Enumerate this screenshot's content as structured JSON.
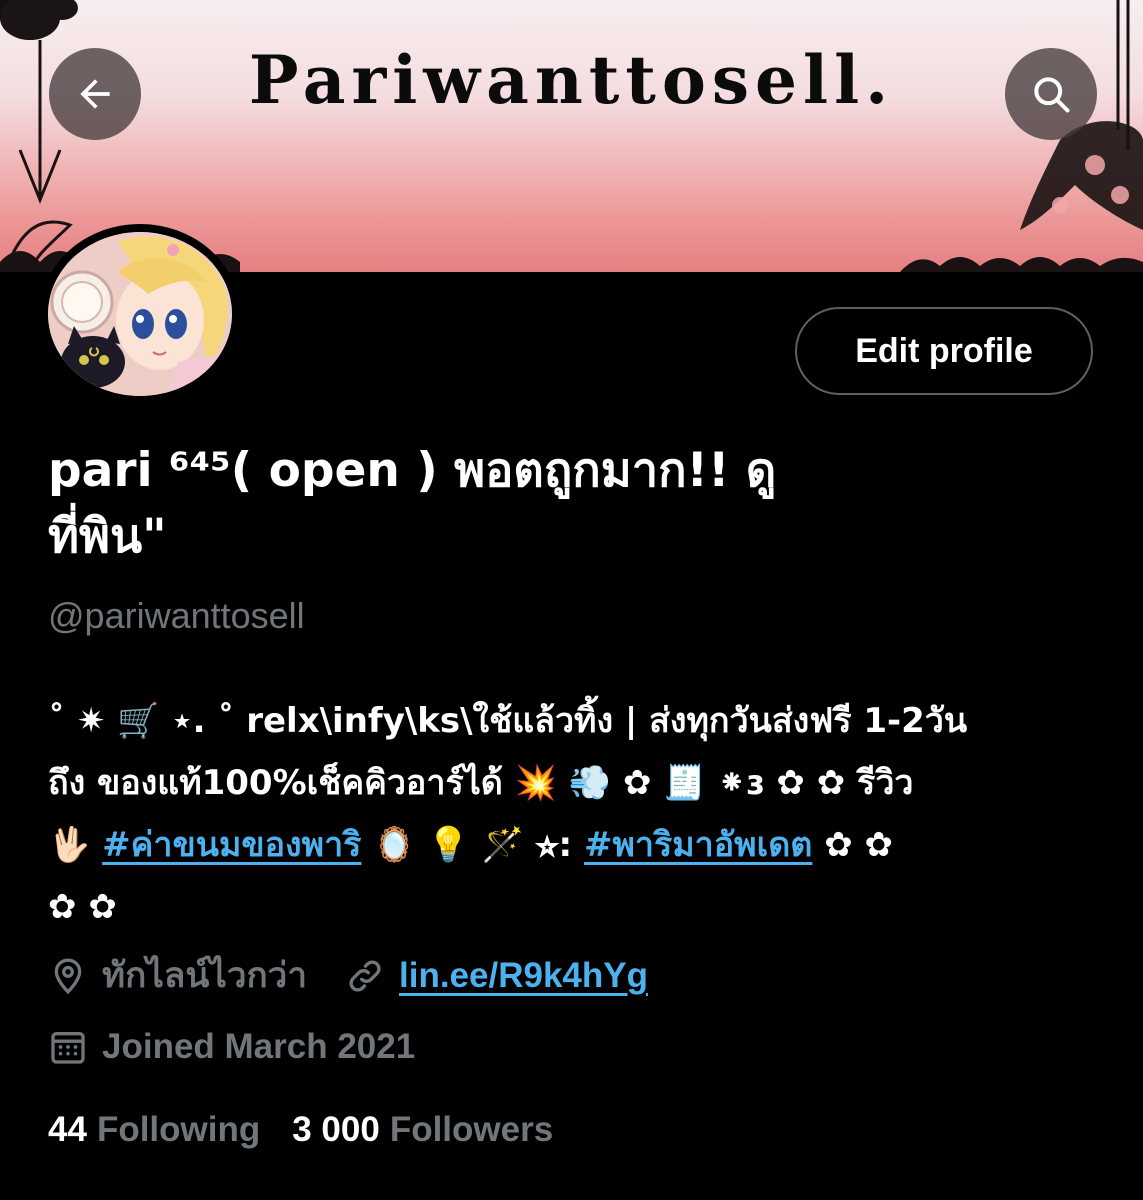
{
  "header": {
    "banner_title": "Pariwanttosell.",
    "back_icon": "arrow-left-icon",
    "search_icon": "search-icon"
  },
  "profile": {
    "avatar": "anime-avatar",
    "edit_label": "Edit profile",
    "display_name_1": "pari ⁶⁴⁵( open ) พอตถูกมาก!! ดู",
    "display_name_2": "ที่พิน\"",
    "handle": "@pariwanttosell"
  },
  "bio": {
    "line1": "˚ ✷ 🛒 ⋆. ˚ relx\\infy\\ks\\ใช้แล้วทิ้ง | ส่งทุกวันส่งฟรี 1-2วัน",
    "line2": "ถึง ของแท้100%เช็คคิวอาร์ได้ 💥 💨 ✿ 🧾 ⁕ɜ ✿ ✿ รีวิว",
    "line3_lead": "🖖🏻 ",
    "hashtag1": "#ค่าขนมของพาริ",
    "line3_mid": " 🪞 💡 🪄 ⭐︎: ",
    "hashtag2": "#พาริมาอัพเดต",
    "line3_end": " ✿ ✿",
    "line4": "✿ ✿"
  },
  "meta": {
    "location": "ทักไลน์ไวกว่า",
    "link": "lin.ee/R9k4hYg",
    "joined": "Joined March 2021"
  },
  "stats": {
    "following_count": "44",
    "following_label": "Following",
    "followers_count": "3 000",
    "followers_label": "Followers"
  },
  "colors": {
    "accent": "#4cb1ee",
    "muted": "#71767b",
    "background": "#000000"
  }
}
